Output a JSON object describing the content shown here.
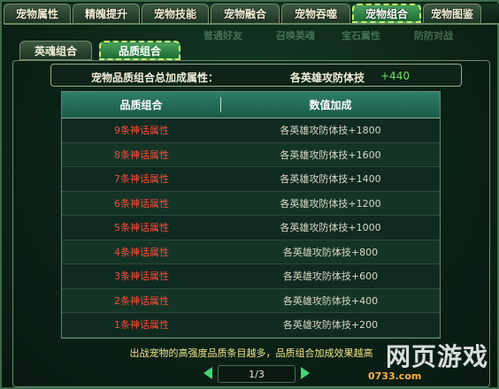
{
  "tabs": [
    {
      "label": "宠物属性",
      "active": false
    },
    {
      "label": "精魄提升",
      "active": false
    },
    {
      "label": "宠物技能",
      "active": false
    },
    {
      "label": "宠物融合",
      "active": false
    },
    {
      "label": "宠物吞噬",
      "active": false
    },
    {
      "label": "宠物组合",
      "active": true
    },
    {
      "label": "宠物图鉴",
      "active": false
    }
  ],
  "subtabs": [
    {
      "label": "英魂组合",
      "active": false
    },
    {
      "label": "品质组合",
      "active": true
    }
  ],
  "ghost_labels": [
    "普通好友",
    "召唤英魂",
    "宝石属性",
    "防防对战"
  ],
  "summary": {
    "label": "宠物品质组合总加成属性：",
    "value": "各英雄攻防体技",
    "plus": "+440"
  },
  "table": {
    "headers": [
      "品质组合",
      "数值加成"
    ],
    "rows": [
      {
        "combo": "9条神话属性",
        "bonus": "各英雄攻防体技+1800"
      },
      {
        "combo": "8条神话属性",
        "bonus": "各英雄攻防体技+1600"
      },
      {
        "combo": "7条神话属性",
        "bonus": "各英雄攻防体技+1400"
      },
      {
        "combo": "6条神话属性",
        "bonus": "各英雄攻防体技+1200"
      },
      {
        "combo": "5条神话属性",
        "bonus": "各英雄攻防体技+1000"
      },
      {
        "combo": "4条神话属性",
        "bonus": "各英雄攻防体技+800"
      },
      {
        "combo": "3条神话属性",
        "bonus": "各英雄攻防体技+600"
      },
      {
        "combo": "2条神话属性",
        "bonus": "各英雄攻防体技+400"
      },
      {
        "combo": "1条神话属性",
        "bonus": "各英雄攻防体技+200"
      }
    ]
  },
  "hint": "出战宠物的高强度品质条目越多，品质组合加成效果越高",
  "pager": {
    "page": "1/3"
  },
  "watermark": {
    "big": "网页游戏",
    "small": "0733.com"
  },
  "colors": {
    "accent": "#c9f06a",
    "red": "#ff4a3a",
    "green": "#6fe06a"
  }
}
